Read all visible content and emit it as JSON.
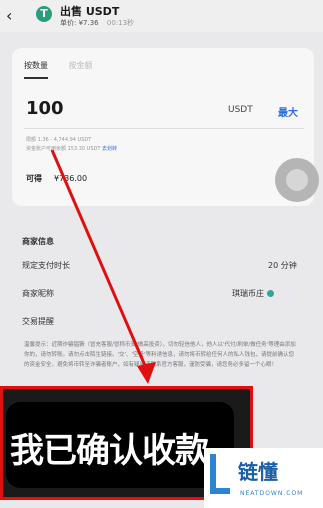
{
  "header": {
    "back_glyph": "‹",
    "coin_letter": "T",
    "title": "出售 USDT",
    "price_text": "单价: ¥7.36",
    "timer": "00:13秒"
  },
  "order": {
    "tabs": [
      {
        "label": "按数量"
      },
      {
        "label": "按金额"
      }
    ],
    "amount": "100",
    "unit": "USDT",
    "max_label": "最大",
    "limit_text": "限额 1.36 - 4,744.94 USDT",
    "balance_text": "资金账户可用余额 153.30 USDT",
    "transfer_link": "去划转",
    "receive_label": "可得",
    "receive_value": "¥736.00"
  },
  "merchant": {
    "section_title": "商家信息",
    "pay_time_label": "规定支付时长",
    "pay_time_value": "20 分钟",
    "nickname_label": "商家昵称",
    "nickname_value": "琪瑞币庄",
    "reminder_label": "交易提醒",
    "notice_text": "温馨提示：近期诈骗猖獗（冒充客服/冒称币安/做高投资）。切勿轻信他人，他人以'代付/刷单/做任务'等理由添加你的，请勿转账。请勿点击陌生链接。'交'、'空投'等利诱信息，请勿将币转给任何人的私人钱包，请提前确认您的资金安全，避免将币转至诈骗者账户，如有疑问请联系官方客服，谨防受骗，请您务必多留一个心眼！"
  },
  "overlay": {
    "caption": "我已确认收款"
  },
  "watermark": {
    "title": "链懂",
    "subtitle": "NEATDOWN.COM"
  }
}
